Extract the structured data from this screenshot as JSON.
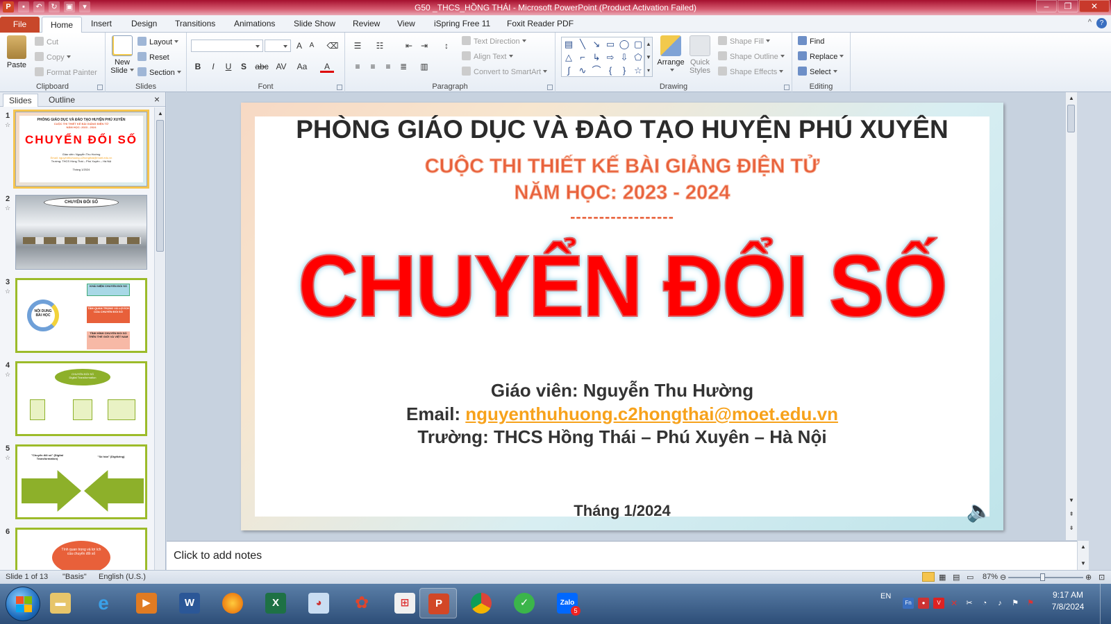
{
  "window": {
    "title": "G50 _THCS_HỒNG THÁI  -  Microsoft PowerPoint (Product Activation Failed)"
  },
  "menu_tabs": [
    "File",
    "Home",
    "Insert",
    "Design",
    "Transitions",
    "Animations",
    "Slide Show",
    "Review",
    "View",
    "iSpring Free 11",
    "Foxit Reader PDF"
  ],
  "ribbon": {
    "clipboard": {
      "paste": "Paste",
      "cut": "Cut",
      "copy": "Copy",
      "format_painter": "Format Painter",
      "label": "Clipboard"
    },
    "slides": {
      "new_slide_line1": "New",
      "new_slide_line2": "Slide",
      "layout": "Layout",
      "reset": "Reset",
      "section": "Section",
      "label": "Slides"
    },
    "font": {
      "label": "Font",
      "bold": "B",
      "italic": "I",
      "underline": "U",
      "shadow": "S",
      "strike": "abc",
      "spacing": "AV",
      "case": "Aa",
      "color": "A",
      "grow": "A",
      "shrink": "A"
    },
    "paragraph": {
      "text_direction": "Text Direction",
      "align_text": "Align Text",
      "convert_smartart": "Convert to SmartArt",
      "label": "Paragraph"
    },
    "drawing": {
      "arrange": "Arrange",
      "quick_styles_line1": "Quick",
      "quick_styles_line2": "Styles",
      "shape_fill": "Shape Fill",
      "shape_outline": "Shape Outline",
      "shape_effects": "Shape Effects",
      "label": "Drawing"
    },
    "editing": {
      "find": "Find",
      "replace": "Replace",
      "select": "Select",
      "label": "Editing"
    }
  },
  "left_panel": {
    "tabs": [
      "Slides",
      "Outline"
    ],
    "close": "×",
    "thumbnails": [
      {
        "num": "1",
        "heading": "PHÒNG GIÁO DỤC VÀ ĐÀO TẠO HUYỆN PHÚ XUYÊN",
        "sub1": "CUỘC THI THIẾT KẾ BÀI GIẢNG ĐIỆN TỬ",
        "sub2": "NĂM HỌC: 2023 - 2024",
        "big": "CHUYỂN ĐỔI SỐ",
        "l1": "Giáo viên: Nguyễn Thu Hường",
        "l2": "Email: nguyenthuhuong.c2hongthai@moet.edu.vn",
        "l3": "Trường: THCS Hồng Thái – Phú Xuyên – Hà Nội",
        "l4": "Tháng 1/2024"
      },
      {
        "num": "2",
        "label": "CHUYỂN ĐỔI SỐ"
      },
      {
        "num": "3",
        "center": "NỘI DUNG BÀI HỌC",
        "b1": "KHÁI NIỆM CHUYỂN ĐỔI SỐ",
        "b2": "TẦM QUAN TRỌNG VÀ LỢI ÍCH CỦA CHUYỂN ĐỔI SỐ",
        "b3": "TÌNH HÌNH CHUYỂN ĐỔI SỐ TRÊN THẾ GIỚI VÀ VIỆT NAM"
      },
      {
        "num": "4",
        "oval_line1": "CHUYỂN ĐỔI SỐ",
        "oval_line2": "Digital Transformation"
      },
      {
        "num": "5",
        "left_label": "\"Chuyển đổi số\" (Digital Transformation)",
        "right_label": "\"Số hóa\" (Digitizing)"
      },
      {
        "num": "6",
        "oval": "Tính quan trọng và lợi ích của chuyển đổi số"
      }
    ]
  },
  "slide": {
    "heading": "PHÒNG GIÁO DỤC VÀ ĐÀO TẠO HUYỆN PHÚ XUYÊN",
    "contest": "CUỘC THI THIẾT KẾ BÀI GIẢNG ĐIỆN TỬ",
    "school_year": "NĂM HỌC: 2023 - 2024",
    "divider": "------------------",
    "title": "CHUYỂN ĐỔI SỐ",
    "teacher": "Giáo viên: Nguyễn Thu Hường",
    "email_label": "Email: ",
    "email_value": "nguyenthuhuong.c2hongthai@moet.edu.vn",
    "school": "Trường: THCS Hồng Thái – Phú Xuyên – Hà Nội",
    "date": "Tháng 1/2024"
  },
  "notes": {
    "placeholder": "Click to add notes"
  },
  "status": {
    "slide_index": "Slide 1 of 13",
    "theme": "\"Basis\"",
    "language": "English (U.S.)",
    "zoom": "87%"
  },
  "taskbar": {
    "lang": "EN",
    "time": "9:17 AM",
    "date": "7/8/2024",
    "zalo_badge": "5"
  },
  "colors": {
    "accent_red": "#ff0000",
    "contest_orange": "#e8603a",
    "email_orange": "#f7a21b",
    "ribbon_file": "#c8472a"
  }
}
